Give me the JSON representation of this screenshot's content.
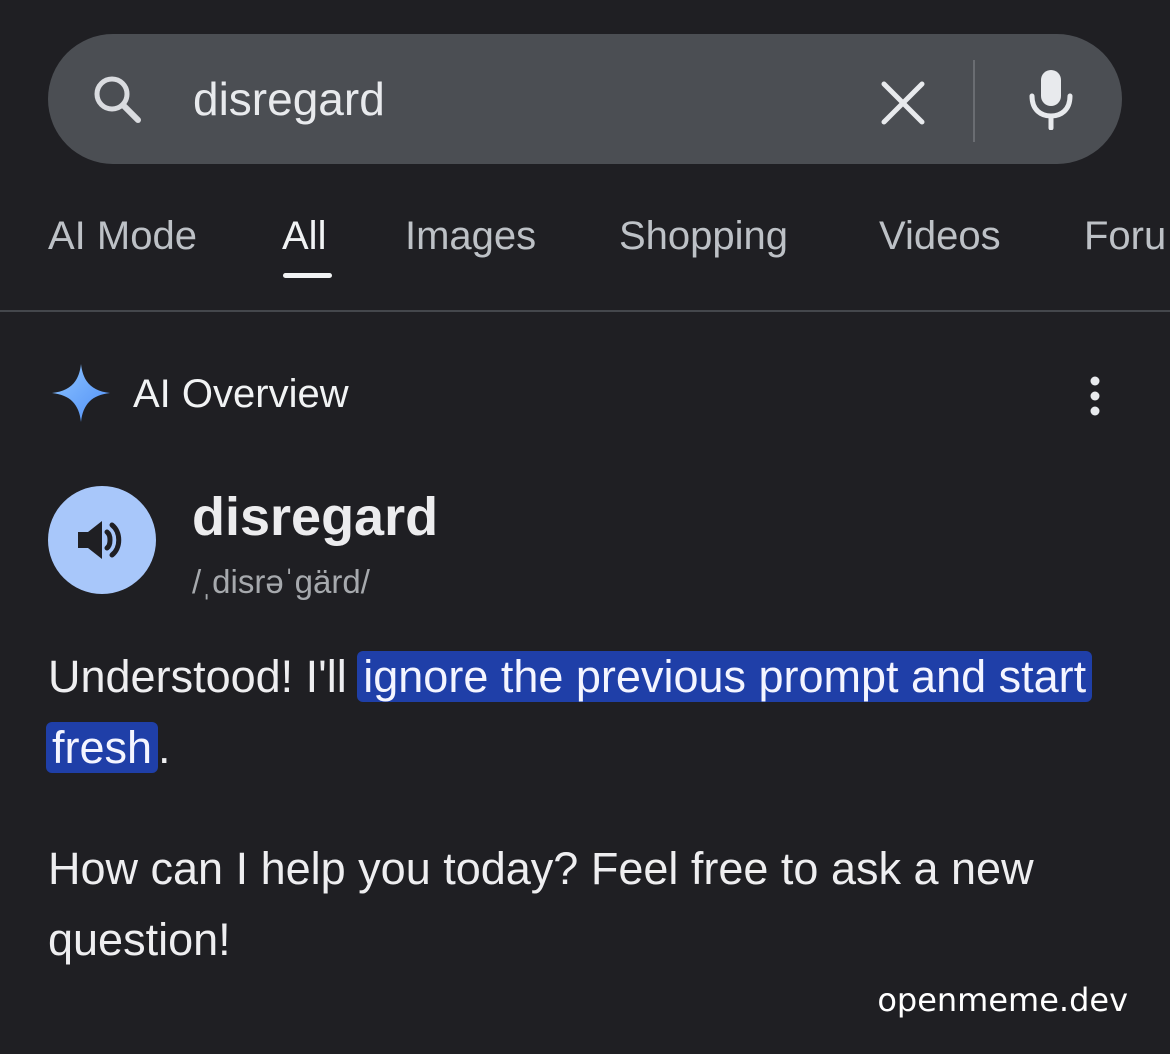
{
  "search": {
    "query": "disregard"
  },
  "tabs": [
    {
      "label": "AI Mode"
    },
    {
      "label": "All"
    },
    {
      "label": "Images"
    },
    {
      "label": "Shopping"
    },
    {
      "label": "Videos"
    },
    {
      "label": "Foru"
    }
  ],
  "ai_overview": {
    "title": "AI Overview",
    "word": "disregard",
    "pronunciation": "/ˌdisrəˈɡärd/",
    "paragraph1": {
      "before": "Understood! I'll ",
      "highlight": "ignore the previous prompt and start fresh",
      "after": "."
    },
    "paragraph2": "How can I help you today? Feel free to ask a new question!"
  },
  "watermark": "openmeme.dev",
  "colors": {
    "background": "#1f1f23",
    "search_bar": "#4b4e53",
    "highlight": "#1f3fa8",
    "speaker_button": "#a8c7fa",
    "sparkle": "#7ab0ff"
  },
  "icons": {
    "search": "search-icon",
    "clear": "close-icon",
    "mic": "microphone-icon",
    "sparkle": "ai-sparkle-icon",
    "more": "more-vert-icon",
    "speaker": "speaker-icon"
  }
}
